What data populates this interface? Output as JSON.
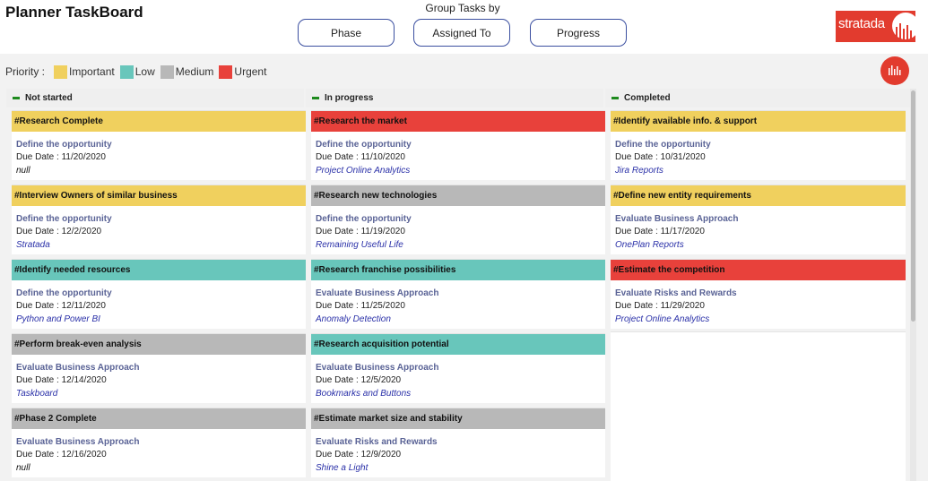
{
  "header": {
    "title": "Planner TaskBoard",
    "group_label": "Group Tasks by",
    "buttons": [
      "Phase",
      "Assigned To",
      "Progress"
    ],
    "logo_text": "stratada"
  },
  "priority": {
    "label": "Priority :",
    "items": [
      {
        "name": "Important",
        "color": "#f0d05e"
      },
      {
        "name": "Low",
        "color": "#68c6bb"
      },
      {
        "name": "Medium",
        "color": "#b8b8b8"
      },
      {
        "name": "Urgent",
        "color": "#e8413b"
      }
    ]
  },
  "columns": [
    {
      "name": "Not started",
      "cards": [
        {
          "title": "#Research Complete",
          "priority": "Important",
          "phase": "Define the opportunity",
          "due": "Due Date : 11/20/2020",
          "bucket": "null"
        },
        {
          "title": "#Interview Owners of similar business",
          "priority": "Important",
          "phase": "Define the opportunity",
          "due": "Due Date : 12/2/2020",
          "bucket": "Stratada"
        },
        {
          "title": "#Identify needed resources",
          "priority": "Low",
          "phase": "Define the opportunity",
          "due": "Due Date : 12/11/2020",
          "bucket": "Python and Power BI"
        },
        {
          "title": "#Perform break-even analysis",
          "priority": "Medium",
          "phase": "Evaluate Business Approach",
          "due": "Due Date : 12/14/2020",
          "bucket": "Taskboard"
        },
        {
          "title": "#Phase 2 Complete",
          "priority": "Medium",
          "phase": "Evaluate Business Approach",
          "due": "Due Date : 12/16/2020",
          "bucket": "null"
        }
      ]
    },
    {
      "name": "In progress",
      "cards": [
        {
          "title": "#Research the market",
          "priority": "Urgent",
          "phase": "Define the opportunity",
          "due": "Due Date : 11/10/2020",
          "bucket": "Project Online Analytics"
        },
        {
          "title": "#Research new technologies",
          "priority": "Medium",
          "phase": "Define the opportunity",
          "due": "Due Date : 11/19/2020",
          "bucket": "Remaining Useful Life"
        },
        {
          "title": "#Research franchise possibilities",
          "priority": "Low",
          "phase": "Evaluate Business Approach",
          "due": "Due Date : 11/25/2020",
          "bucket": "Anomaly Detection"
        },
        {
          "title": "#Research acquisition potential",
          "priority": "Low",
          "phase": "Evaluate Business Approach",
          "due": "Due Date : 12/5/2020",
          "bucket": "Bookmarks and Buttons"
        },
        {
          "title": "#Estimate market size and stability",
          "priority": "Medium",
          "phase": "Evaluate Risks and Rewards",
          "due": "Due Date : 12/9/2020",
          "bucket": "Shine a Light"
        }
      ]
    },
    {
      "name": "Completed",
      "cards": [
        {
          "title": "#Identify available info. & support",
          "priority": "Important",
          "phase": "Define the opportunity",
          "due": "Due Date : 10/31/2020",
          "bucket": "Jira Reports"
        },
        {
          "title": "#Define new entity requirements",
          "priority": "Important",
          "phase": "Evaluate Business Approach",
          "due": "Due Date : 11/17/2020",
          "bucket": "OnePlan Reports"
        },
        {
          "title": "#Estimate the competition",
          "priority": "Urgent",
          "phase": "Evaluate Risks and Rewards",
          "due": "Due Date : 11/29/2020",
          "bucket": "Project Online Analytics"
        }
      ]
    }
  ]
}
